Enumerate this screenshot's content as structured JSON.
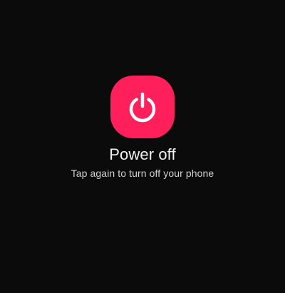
{
  "power_prompt": {
    "button_color": "#ff1f5a",
    "icon": "power-icon",
    "title": "Power off",
    "subtitle": "Tap again to turn off your phone"
  },
  "colors": {
    "background": "#0b0b0b",
    "title_text": "#f2f2f2",
    "subtitle_text": "#d0d0d0"
  }
}
